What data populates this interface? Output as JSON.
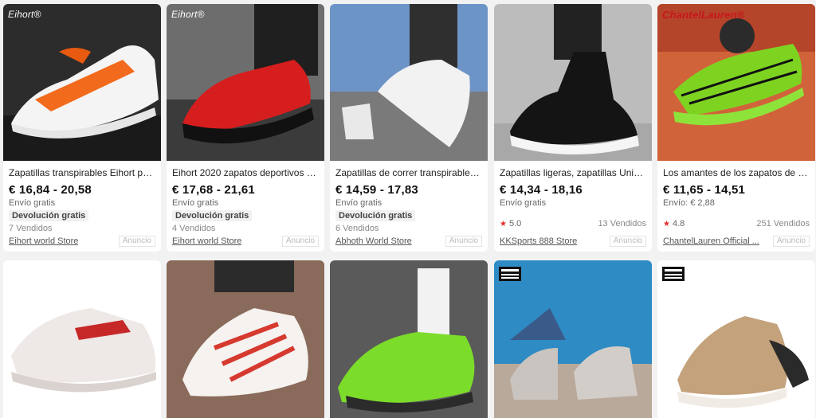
{
  "products": [
    {
      "logo": "Eihort®",
      "title": "Zapatillas transpirables Eihort par...",
      "price": "€ 16,84 - 20,58",
      "shipping": "Envío gratis",
      "badge": "Devolución gratis",
      "sold": "7 Vendidos",
      "store": "Eihort world Store",
      "ad": "Anuncio"
    },
    {
      "logo": "Eihort®",
      "title": "Eihort 2020 zapatos deportivos de ...",
      "price": "€ 17,68 - 21,61",
      "shipping": "Envío gratis",
      "badge": "Devolución gratis",
      "sold": "4 Vendidos",
      "store": "Eihort world Store",
      "ad": "Anuncio"
    },
    {
      "title": "Zapatillas de correr transpirables ...",
      "price": "€ 14,59 - 17,83",
      "shipping": "Envío gratis",
      "badge": "Devolución gratis",
      "sold": "6 Vendidos",
      "store": "Abhoth World Store",
      "ad": "Anuncio"
    },
    {
      "title": "Zapatillas ligeras, zapatillas Unisex...",
      "price": "€ 14,34 - 18,16",
      "shipping": "Envío gratis",
      "rating": "5.0",
      "sold": "13 Vendidos",
      "store": "KKSports 888 Store",
      "ad": "Anuncio"
    },
    {
      "logo": "ChantelLauren®",
      "title": "Los amantes de los zapatos de los ...",
      "price": "€ 11,65 - 14,51",
      "shipping": "Envío: € 2,88",
      "rating": "4.8",
      "sold": "251 Vendidos",
      "store": "ChantelLauren Official ...",
      "ad": "Anuncio"
    }
  ],
  "icons": {
    "star": "star-icon"
  },
  "colors": {
    "accent": "#e62e2e",
    "badge_bg": "#f1f1f1",
    "page_bg": "#f2f2f2"
  }
}
